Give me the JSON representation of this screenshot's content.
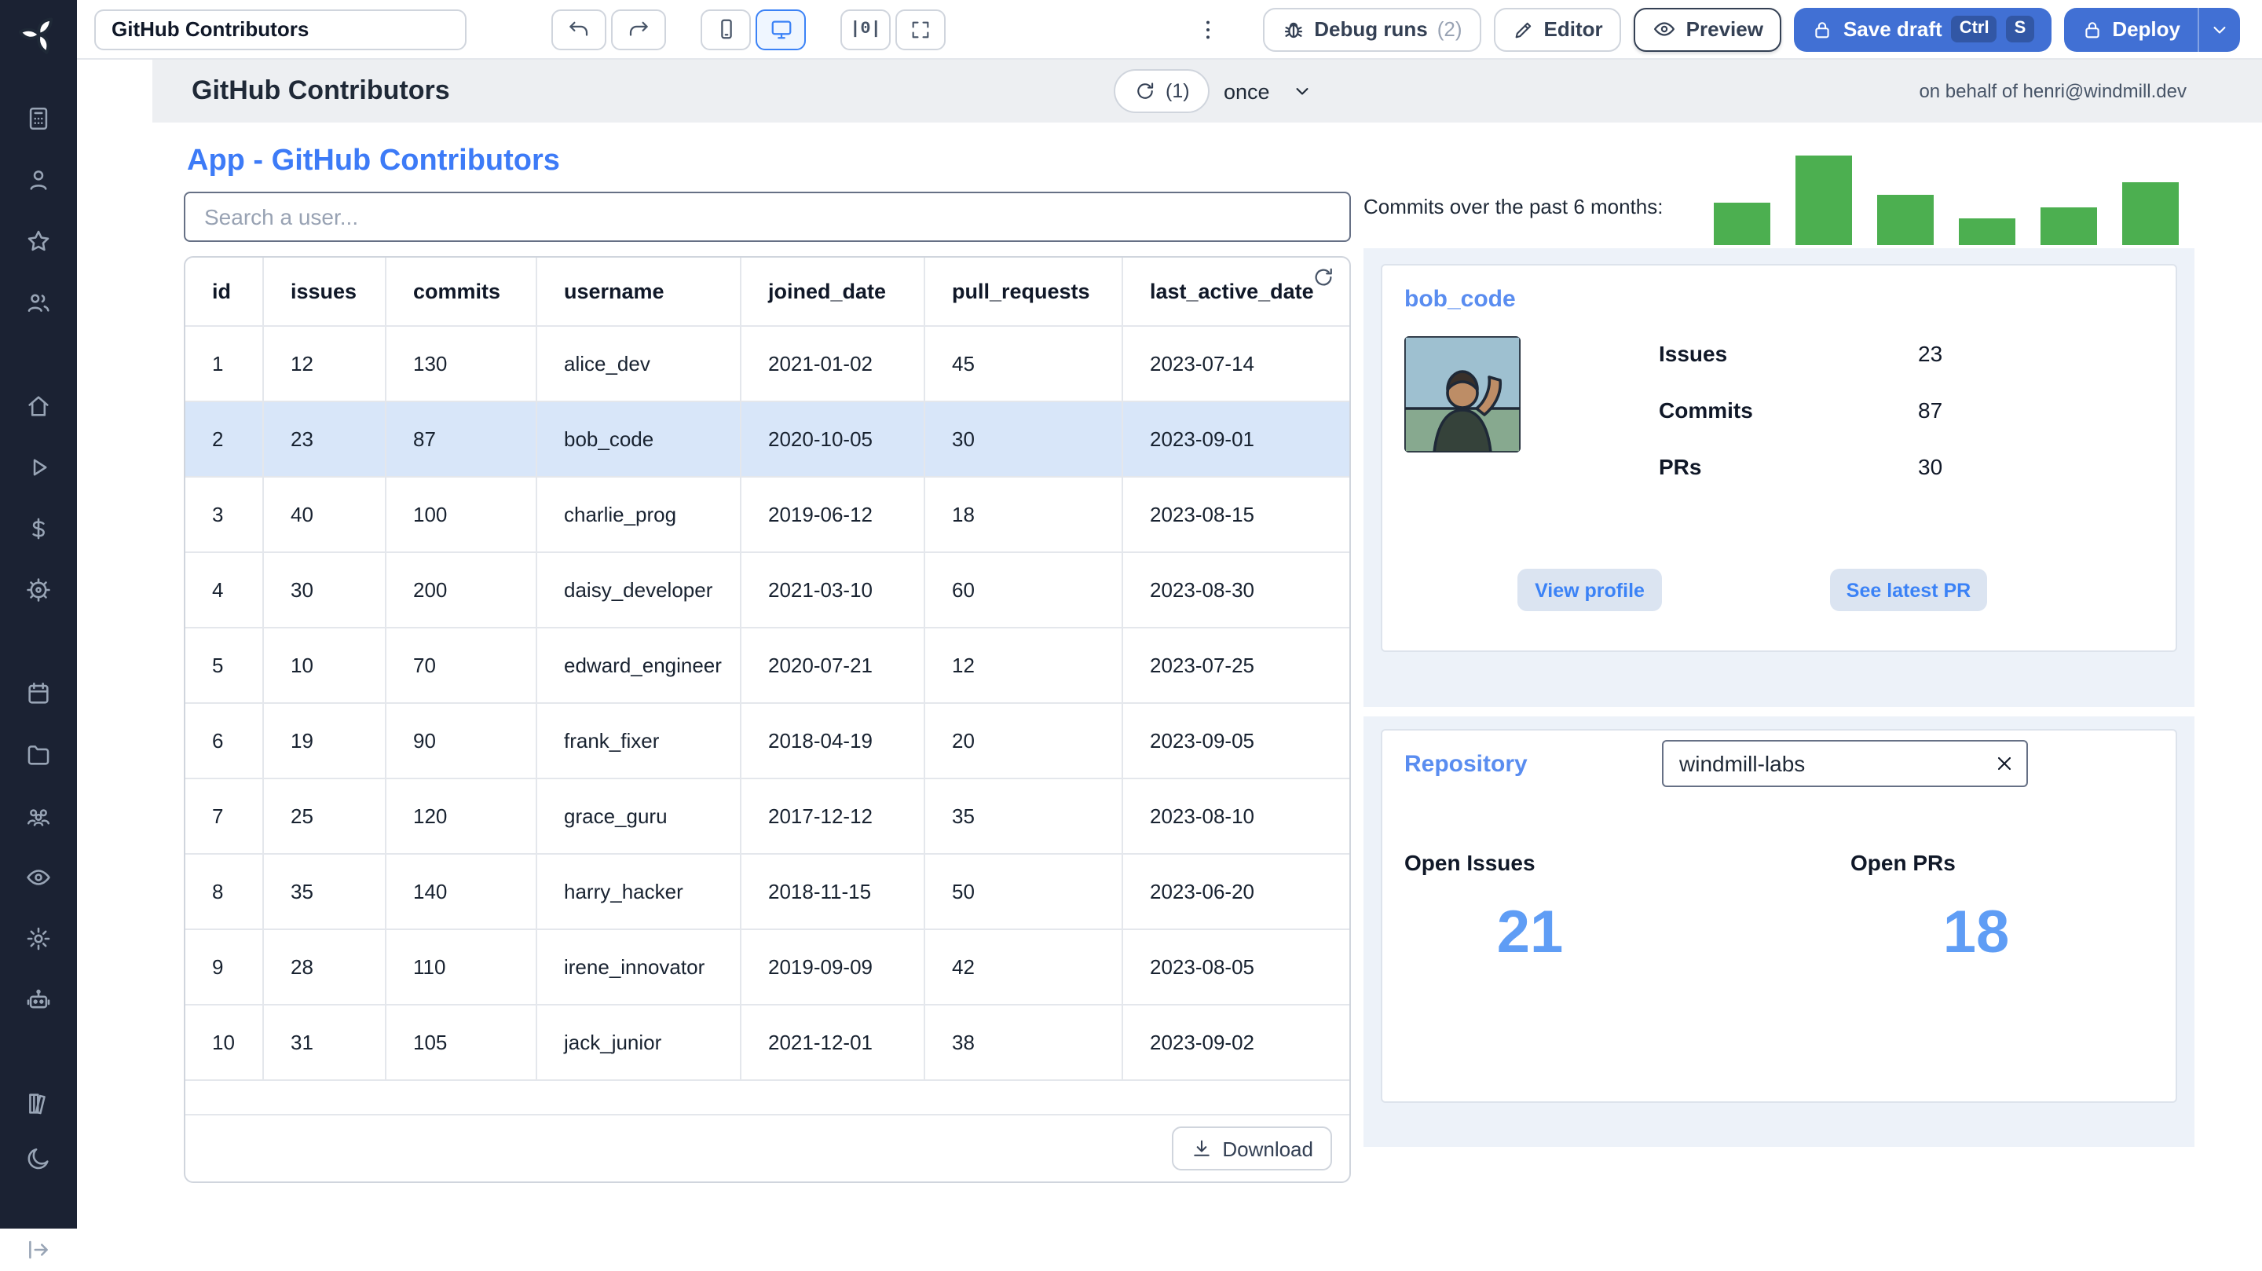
{
  "toolbar": {
    "app_name_value": "GitHub Contributors",
    "align_glyph": "|0|",
    "debug_runs_label": "Debug runs",
    "debug_runs_count": "(2)",
    "editor_label": "Editor",
    "preview_label": "Preview",
    "save_draft_label": "Save draft",
    "save_kbd_1": "Ctrl",
    "save_kbd_2": "S",
    "deploy_label": "Deploy"
  },
  "app_header": {
    "title": "GitHub Contributors",
    "refresh_badge": "(1)",
    "schedule_value": "once",
    "on_behalf_of": "on behalf of henri@windmill.dev"
  },
  "sidebar": {
    "groups": [
      [
        "apps",
        "user",
        "star",
        "users"
      ],
      [
        "home",
        "play",
        "dollar",
        "helm"
      ],
      [
        "calendar",
        "folder",
        "team",
        "eye",
        "gear",
        "robot"
      ]
    ],
    "bottom": [
      "books",
      "moon"
    ],
    "footer": [
      "collapse"
    ]
  },
  "main": {
    "page_title": "App - GitHub Contributors",
    "search_placeholder": "Search a user...",
    "table": {
      "columns": [
        "id",
        "issues",
        "commits",
        "username",
        "joined_date",
        "pull_requests",
        "last_active_date"
      ],
      "rows": [
        [
          "1",
          "12",
          "130",
          "alice_dev",
          "2021-01-02",
          "45",
          "2023-07-14"
        ],
        [
          "2",
          "23",
          "87",
          "bob_code",
          "2020-10-05",
          "30",
          "2023-09-01"
        ],
        [
          "3",
          "40",
          "100",
          "charlie_prog",
          "2019-06-12",
          "18",
          "2023-08-15"
        ],
        [
          "4",
          "30",
          "200",
          "daisy_developer",
          "2021-03-10",
          "60",
          "2023-08-30"
        ],
        [
          "5",
          "10",
          "70",
          "edward_engineer",
          "2020-07-21",
          "12",
          "2023-07-25"
        ],
        [
          "6",
          "19",
          "90",
          "frank_fixer",
          "2018-04-19",
          "20",
          "2023-09-05"
        ],
        [
          "7",
          "25",
          "120",
          "grace_guru",
          "2017-12-12",
          "35",
          "2023-08-10"
        ],
        [
          "8",
          "35",
          "140",
          "harry_hacker",
          "2018-11-15",
          "50",
          "2023-06-20"
        ],
        [
          "9",
          "28",
          "110",
          "irene_innovator",
          "2019-09-09",
          "42",
          "2023-08-05"
        ],
        [
          "10",
          "31",
          "105",
          "jack_junior",
          "2021-12-01",
          "38",
          "2023-09-02"
        ]
      ],
      "selected_row": 1,
      "download_label": "Download"
    }
  },
  "right_panel": {
    "chart_label": "Commits over the past 6 months:",
    "contributor_card": {
      "name": "bob_code",
      "stats": [
        {
          "label": "Issues",
          "value": "23"
        },
        {
          "label": "Commits",
          "value": "87"
        },
        {
          "label": "PRs",
          "value": "30"
        }
      ],
      "view_profile_label": "View profile",
      "see_latest_pr_label": "See latest PR"
    },
    "repository_card": {
      "title": "Repository",
      "repo_input_value": "windmill-labs",
      "metrics": [
        {
          "label": "Open Issues",
          "value": "21"
        },
        {
          "label": "Open PRs",
          "value": "18"
        }
      ]
    }
  },
  "chart_data": {
    "type": "bar",
    "title": "Commits over the past 6 months:",
    "values": [
      29,
      62,
      35,
      19,
      26,
      44
    ],
    "ylim": [
      0,
      65
    ],
    "legend": false,
    "grid": false,
    "color": "#4caf50"
  },
  "colors": {
    "accent_blue": "#4170d4",
    "link_blue": "#3d7bf7",
    "card_title_blue": "#5a8df0",
    "big_number_blue": "#5f9df5",
    "bar_green": "#4caf50",
    "selected_row": "#d8e6f9",
    "sidebar_bg": "#1b2233",
    "header_band": "#edeff2",
    "panel_bg": "#edf2f9"
  }
}
